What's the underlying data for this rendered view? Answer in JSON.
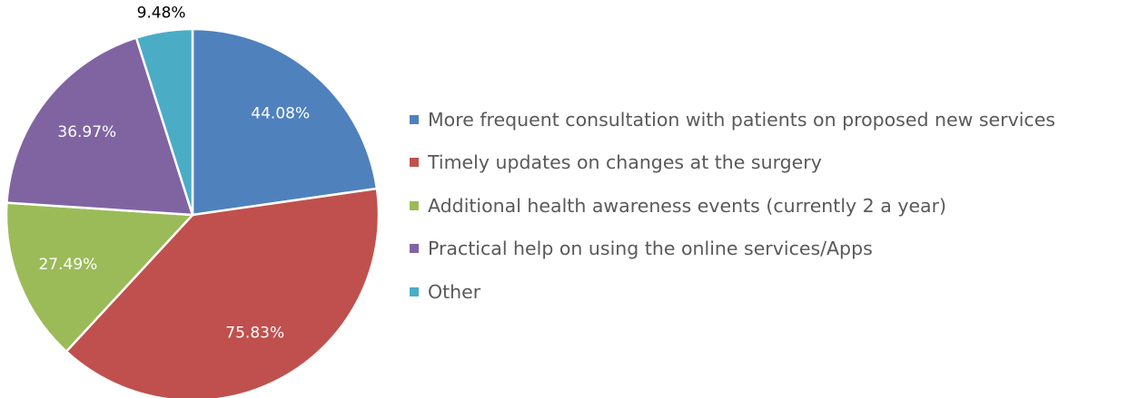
{
  "chart_data": {
    "type": "pie",
    "title": "",
    "categories": [
      "More frequent consultation with patients on proposed new services",
      "Timely updates on changes at the surgery",
      "Additional health awareness events (currently 2 a year)",
      "Practical help on using the online services/Apps",
      "Other"
    ],
    "values": [
      44.08,
      75.83,
      27.49,
      36.97,
      9.48
    ],
    "data_labels": [
      "44.08%",
      "75.83%",
      "27.49%",
      "36.97%",
      "9.48%"
    ],
    "colors": [
      "#4F81BD",
      "#C0504D",
      "#9BBB59",
      "#8064A2",
      "#4BACC6"
    ],
    "label_colors": [
      "#ffffff",
      "#ffffff",
      "#ffffff",
      "#ffffff",
      "#000000"
    ],
    "start_angle": "12 o'clock",
    "direction": "clockwise",
    "legend_position": "right"
  }
}
